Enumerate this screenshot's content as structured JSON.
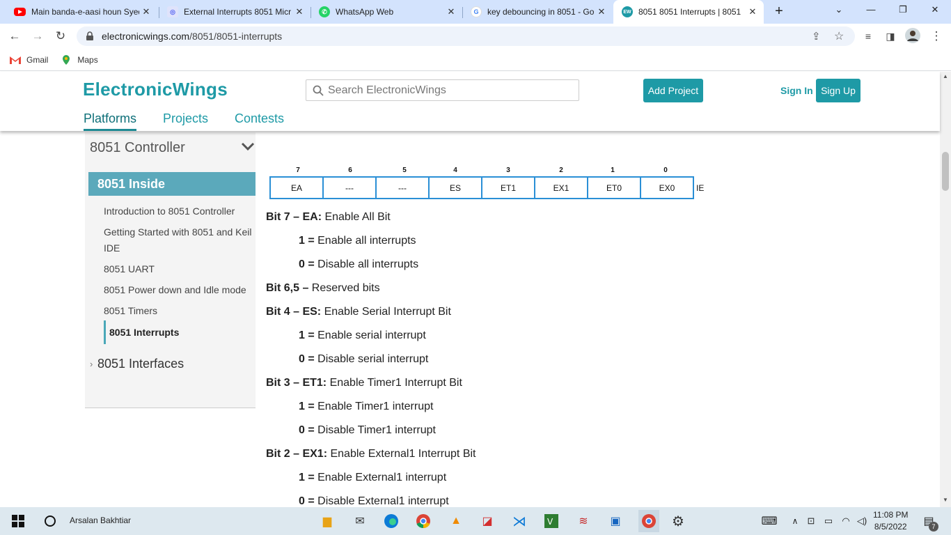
{
  "browser": {
    "tabs": [
      {
        "title": "Main banda-e-aasi houn Syed",
        "icon": "youtube-icon",
        "color": "#ff0000"
      },
      {
        "title": "External Interrupts 8051 Micr",
        "icon": "tab-favicon-icon",
        "color": "#5865f2"
      },
      {
        "title": "WhatsApp Web",
        "icon": "whatsapp-icon",
        "color": "#25d366"
      },
      {
        "title": "key debouncing in 8051 - Go",
        "icon": "google-icon",
        "color": "#4285f4"
      },
      {
        "title": "8051 8051 Interrupts | 8051",
        "icon": "electronicwings-icon",
        "color": "#1e9aa6",
        "fav_text": "EW"
      }
    ],
    "close_glyph": "✕",
    "url_domain": "electronicwings.com",
    "url_path": "/8051/8051-interrupts",
    "bookmarks": [
      {
        "label": "Gmail",
        "icon": "gmail-icon"
      },
      {
        "label": "Maps",
        "icon": "maps-icon"
      }
    ]
  },
  "site": {
    "logo": "ElectronicWings",
    "search_placeholder": "Search ElectronicWings",
    "add_project": "Add Project",
    "sign_in": "Sign In",
    "sign_up": "Sign Up",
    "nav": [
      "Platforms",
      "Projects",
      "Contests"
    ],
    "accent_color": "#1e9aa6"
  },
  "sidebar": {
    "title": "8051 Controller",
    "section": "8051 Inside",
    "items": [
      "Introduction to 8051 Controller",
      "Getting Started with 8051 and Keil IDE",
      "8051 UART",
      "8051 Power down and Idle mode",
      "8051 Timers"
    ],
    "active_item": "8051 Interrupts",
    "next_section": "8051 Interfaces"
  },
  "register": {
    "bit_numbers": [
      "7",
      "6",
      "5",
      "4",
      "3",
      "2",
      "1",
      "0"
    ],
    "cells": [
      "EA",
      "---",
      "---",
      "ES",
      "ET1",
      "EX1",
      "ET0",
      "EX0"
    ],
    "name": "IE"
  },
  "content": {
    "bit7_head": "Bit 7 – EA:",
    "bit7_desc": " Enable All Bit",
    "bit7_1_key": "1 =",
    "bit7_1_val": " Enable all interrupts",
    "bit7_0_key": "0 =",
    "bit7_0_val": " Disable all interrupts",
    "bit65_head": "Bit 6,5 –",
    "bit65_desc": " Reserved bits",
    "bit4_head": "Bit 4 – ES:",
    "bit4_desc": " Enable Serial Interrupt Bit",
    "bit4_1_key": "1 =",
    "bit4_1_val": " Enable serial interrupt",
    "bit4_0_key": "0 =",
    "bit4_0_val": " Disable serial interrupt",
    "bit3_head": "Bit 3 – ET1:",
    "bit3_desc": " Enable Timer1 Interrupt Bit",
    "bit3_1_key": "1 =",
    "bit3_1_val": " Enable Timer1 interrupt",
    "bit3_0_key": "0 =",
    "bit3_0_val": " Disable Timer1 interrupt",
    "bit2_head": "Bit 2 – EX1:",
    "bit2_desc": " Enable External1 Interrupt Bit",
    "bit2_1_key": "1 =",
    "bit2_1_val": " Enable External1 interrupt",
    "bit2_0_key": "0 =",
    "bit2_0_val": " Disable External1 interrupt"
  },
  "taskbar": {
    "user": "Arsalan Bakhtiar",
    "time": "11:08 PM",
    "date": "8/5/2022",
    "notification_count": "7"
  }
}
